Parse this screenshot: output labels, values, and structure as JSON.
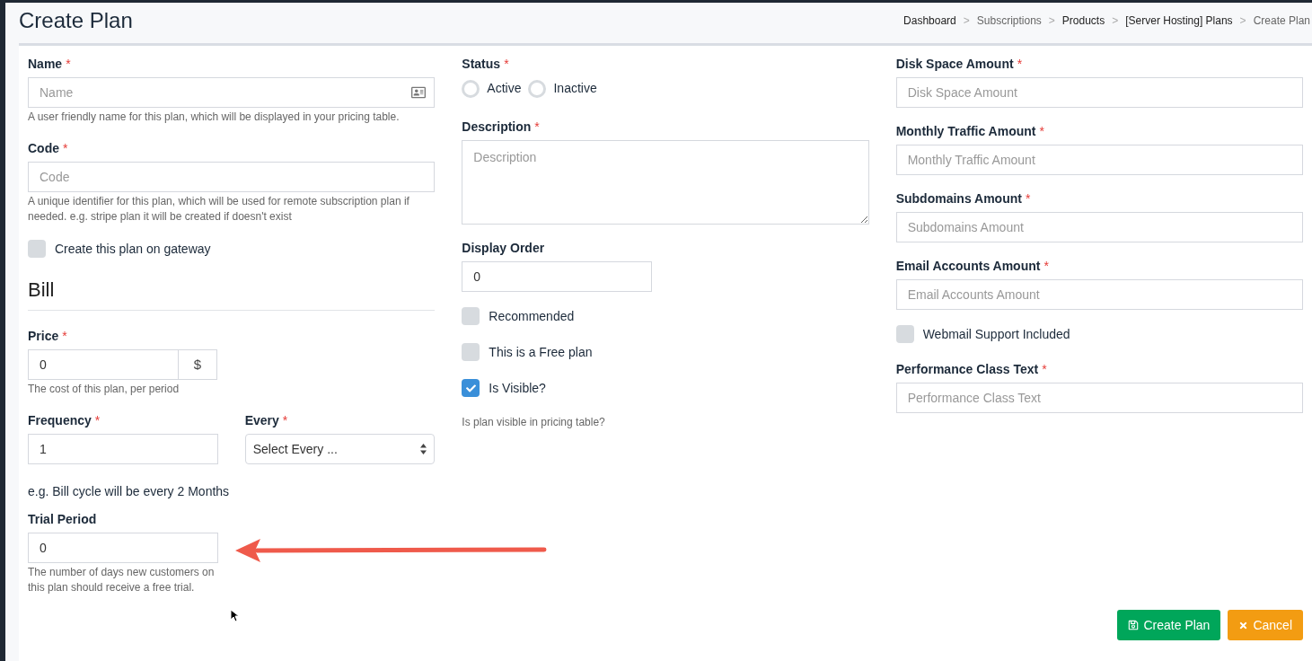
{
  "header": {
    "title": "Create Plan",
    "separator": ">",
    "breadcrumb": [
      {
        "label": "Dashboard",
        "muted": false
      },
      {
        "label": "Subscriptions",
        "muted": true
      },
      {
        "label": "Products",
        "muted": false
      },
      {
        "label": "[Server Hosting] Plans",
        "muted": false
      },
      {
        "label": "Create Plan",
        "muted": true
      }
    ]
  },
  "form": {
    "required_mark": "*",
    "columns": [
      [
        {
          "kind": "input_icon",
          "label": "Name",
          "required": true,
          "placeholder": "Name",
          "help": "A user friendly name for this plan, which will be displayed in your pricing table."
        },
        {
          "kind": "input",
          "label": "Code",
          "required": true,
          "placeholder": "Code",
          "help": "A unique identifier for this plan, which will be used for remote subscription plan if needed. e.g. stripe plan it will be created if doesn't exist"
        },
        {
          "kind": "checkbox",
          "label": "Create this plan on gateway",
          "checked": false
        },
        {
          "kind": "heading",
          "label": "Bill"
        },
        {
          "kind": "addon",
          "label": "Price",
          "required": true,
          "value": "0",
          "addon": "$",
          "help": "The cost of this plan, per period"
        },
        {
          "kind": "pair",
          "items": [
            {
              "kind": "input",
              "label": "Frequency",
              "required": true,
              "value": "1"
            },
            {
              "kind": "select",
              "label": "Every",
              "required": true,
              "value": "Select Every ..."
            }
          ]
        },
        {
          "kind": "note",
          "label": "e.g. Bill cycle will be every 2 Months"
        },
        {
          "kind": "short_input",
          "label": "Trial Period",
          "required": false,
          "value": "0",
          "help": "The number of days new customers on this plan should receive a free trial."
        }
      ],
      [
        {
          "kind": "radio",
          "label": "Status",
          "required": true,
          "options": [
            {
              "label": "Active",
              "selected": false
            },
            {
              "label": "Inactive",
              "selected": false
            }
          ]
        },
        {
          "kind": "textarea",
          "label": "Description",
          "required": true,
          "placeholder": "Description"
        },
        {
          "kind": "short_input",
          "label": "Display Order",
          "required": false,
          "value": "0"
        },
        {
          "kind": "checkbox",
          "label": "Recommended",
          "checked": false
        },
        {
          "kind": "checkbox",
          "label": "This is a Free plan",
          "checked": false
        },
        {
          "kind": "checkbox",
          "label": "Is Visible?",
          "checked": true
        },
        {
          "kind": "small_note",
          "label": "Is plan visible in pricing table?"
        }
      ],
      [
        {
          "kind": "input",
          "label": "Disk Space Amount",
          "required": true,
          "placeholder": "Disk Space Amount"
        },
        {
          "kind": "input",
          "label": "Monthly Traffic Amount",
          "required": true,
          "placeholder": "Monthly Traffic Amount"
        },
        {
          "kind": "input",
          "label": "Subdomains Amount",
          "required": true,
          "placeholder": "Subdomains Amount"
        },
        {
          "kind": "input",
          "label": "Email Accounts Amount",
          "required": true,
          "placeholder": "Email Accounts Amount"
        },
        {
          "kind": "checkbox",
          "label": "Webmail Support Included",
          "checked": false
        },
        {
          "kind": "input",
          "label": "Performance Class Text",
          "required": true,
          "placeholder": "Performance Class Text"
        }
      ]
    ]
  },
  "actions": [
    {
      "kind": "save",
      "label": "Create Plan"
    },
    {
      "kind": "cancel",
      "label": "Cancel"
    }
  ]
}
